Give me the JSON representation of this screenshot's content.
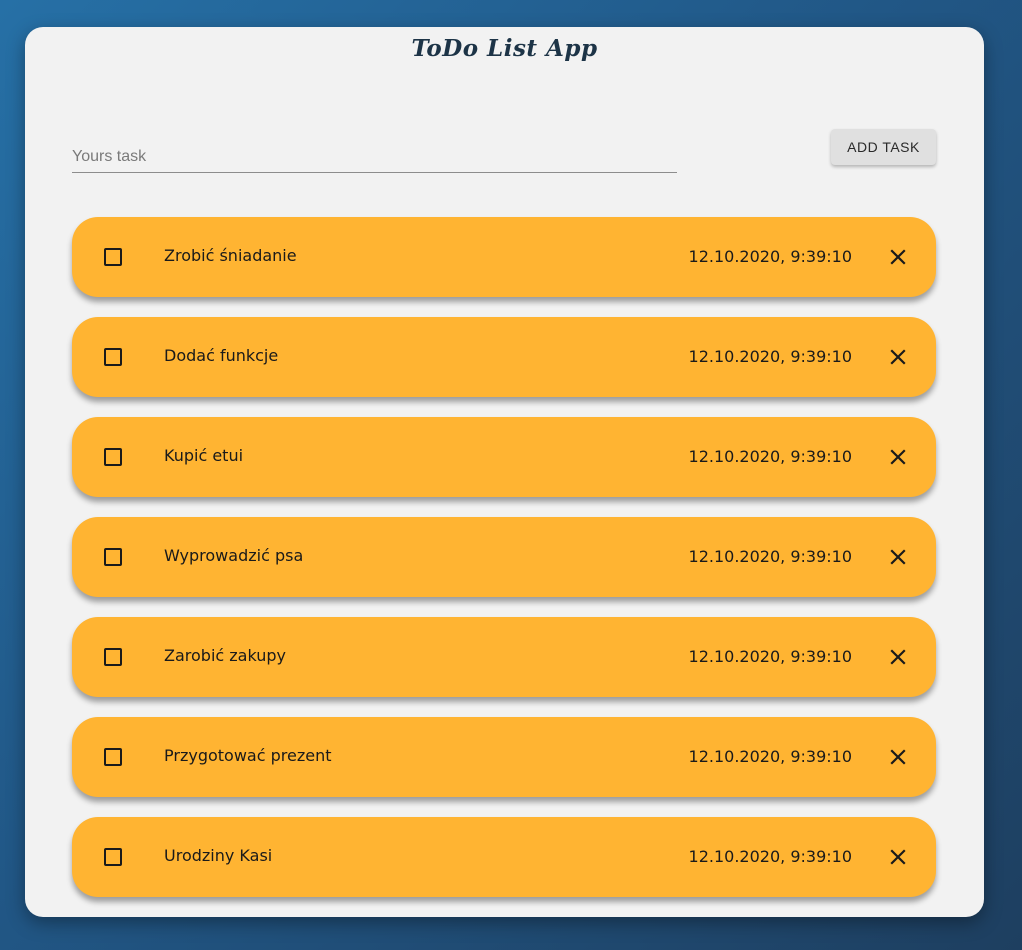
{
  "app": {
    "title": "ToDo List App"
  },
  "form": {
    "task_placeholder": "Yours task",
    "task_value": "",
    "add_button_label": "ADD TASK"
  },
  "tasks": [
    {
      "text": "Zrobić śniadanie",
      "date": "12.10.2020, 9:39:10",
      "done": false
    },
    {
      "text": "Dodać funkcje",
      "date": "12.10.2020, 9:39:10",
      "done": false
    },
    {
      "text": "Kupić etui",
      "date": "12.10.2020, 9:39:10",
      "done": false
    },
    {
      "text": "Wyprowadzić psa",
      "date": "12.10.2020, 9:39:10",
      "done": false
    },
    {
      "text": "Zarobić zakupy",
      "date": "12.10.2020, 9:39:10",
      "done": false
    },
    {
      "text": "Przygotować prezent",
      "date": "12.10.2020, 9:39:10",
      "done": false
    },
    {
      "text": "Urodziny Kasi",
      "date": "12.10.2020, 9:39:10",
      "done": false
    }
  ],
  "icons": {
    "checkbox": "checkbox-outline-icon",
    "delete": "close-icon"
  },
  "colors": {
    "background_start": "#2670a6",
    "background_end": "#1e3f60",
    "card": "#f2f2f2",
    "task_item": "#ffb432",
    "title": "#1d3447"
  }
}
